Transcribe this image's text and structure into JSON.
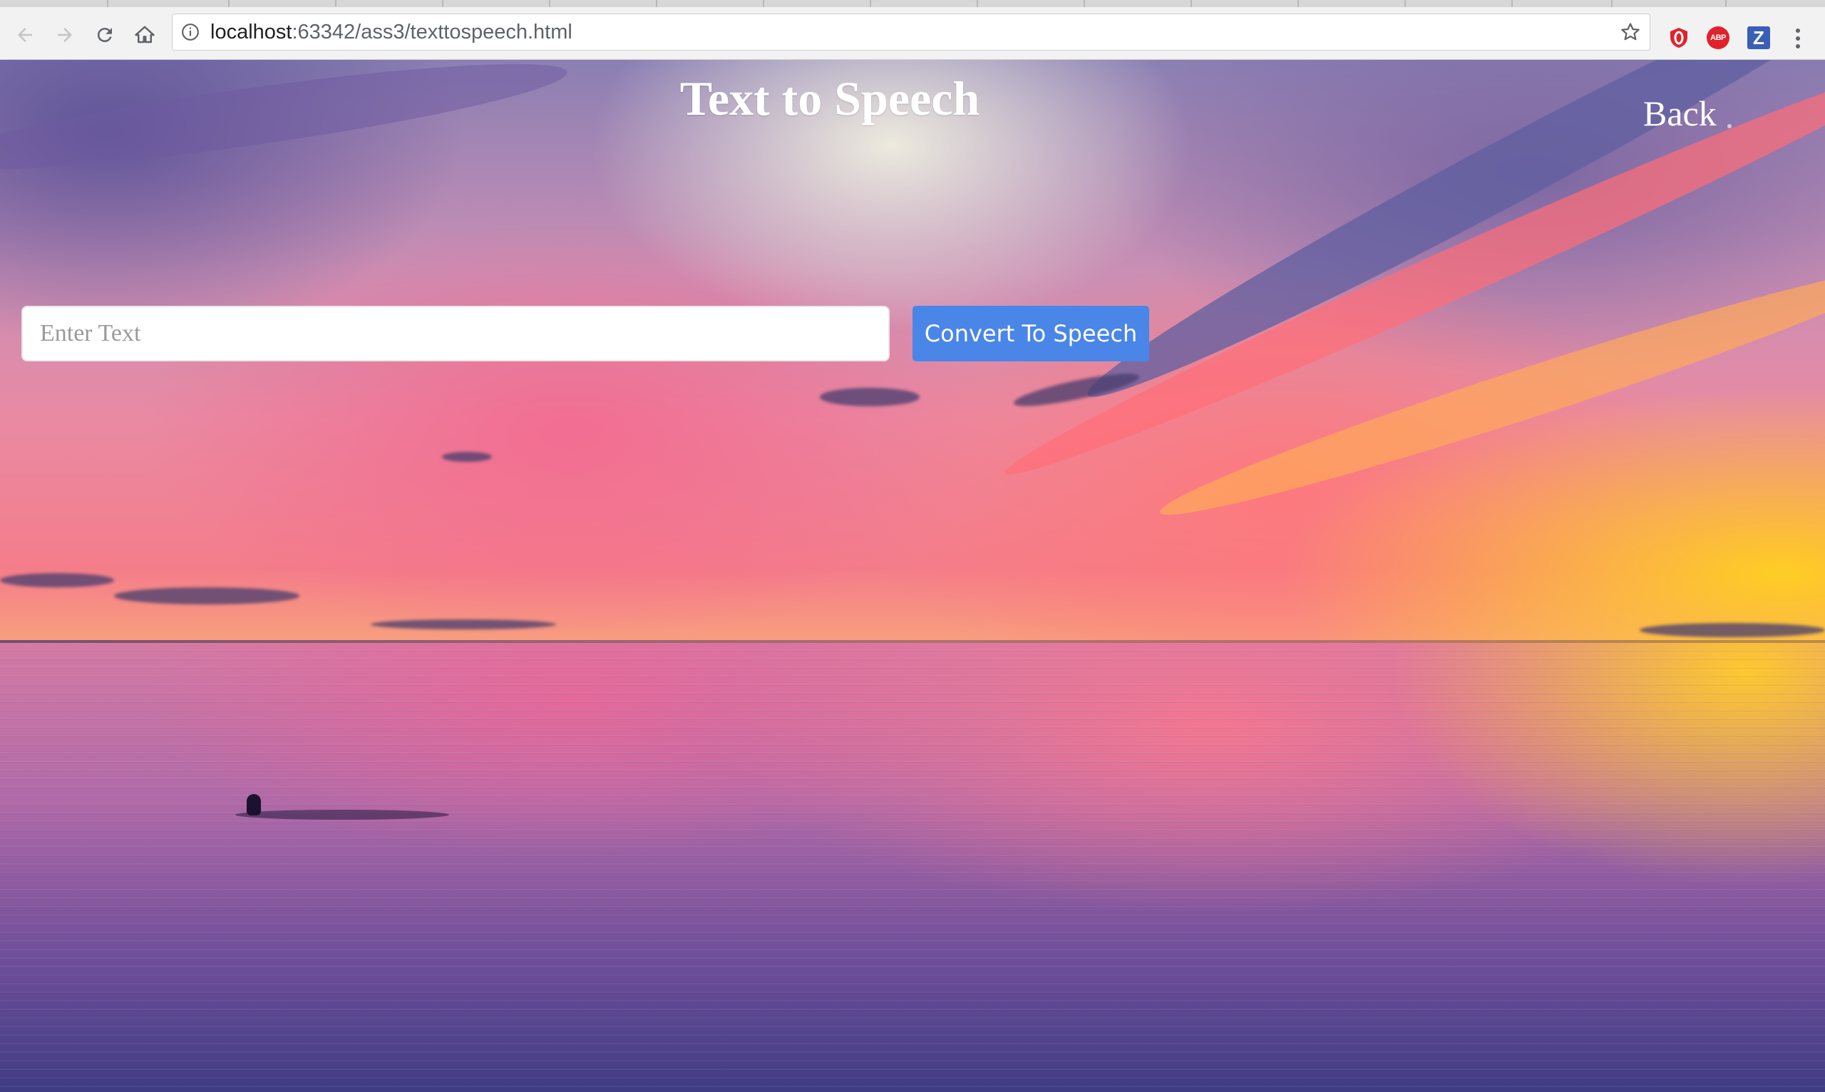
{
  "browser": {
    "url_host": "localhost",
    "url_rest": ":63342/ass3/texttospeech.html",
    "icons": {
      "back": "back-arrow-icon",
      "forward": "forward-arrow-icon",
      "reload": "reload-icon",
      "home": "home-icon",
      "info": "info-icon",
      "bookmark": "star-icon",
      "ext1": "opera-vpn-icon",
      "ext2": "adblock-plus-icon",
      "ext3": "zotero-icon",
      "menu": "more-vert-icon"
    },
    "ext_abp_label": "ABP",
    "ext_z_label": "Z"
  },
  "page": {
    "title": "Text to Speech",
    "back_label": "Back",
    "input_placeholder": "Enter Text",
    "input_value": "",
    "convert_label": "Convert To Speech"
  },
  "colors": {
    "button": "#4a86e8",
    "title_text": "#ffffff",
    "input_bg": "#ffffff"
  }
}
